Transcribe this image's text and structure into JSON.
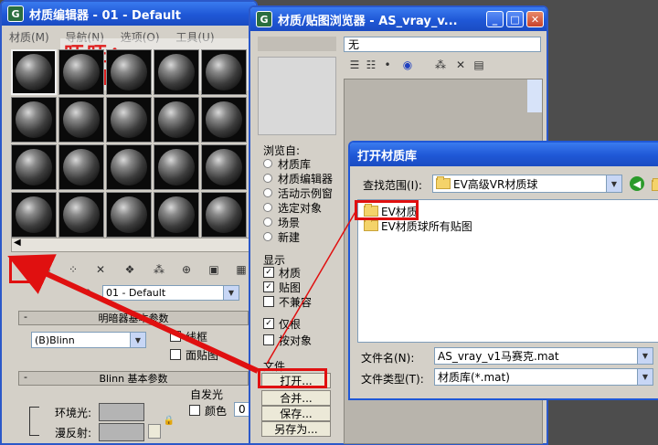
{
  "watermark": "旺旺：tailin188",
  "material_editor": {
    "title": "材质编辑器 - 01 - Default",
    "menu": [
      "材质(M)",
      "导航(N)",
      "选项(O)",
      "工具(U)"
    ],
    "material_name": "01 - Default",
    "basic_params_title": "明暗器基本参数",
    "shader": "(B)Blinn",
    "wire_label": "线框",
    "faceted_label": "面贴图",
    "blinn_title": "Blinn 基本参数",
    "self_illum_label": "自发光",
    "color_label": "颜色",
    "color_value": "0",
    "ambient_label": "环境光:",
    "diffuse_label": "漫反射:"
  },
  "browser": {
    "title": "材质/贴图浏览器 - AS_vray_v...",
    "name_value": "无",
    "browse_from_label": "浏览自:",
    "browse_from": [
      "材质库",
      "材质编辑器",
      "活动示例窗",
      "选定对象",
      "场景",
      "新建"
    ],
    "show_label": "显示",
    "show": [
      {
        "label": "材质",
        "checked": true
      },
      {
        "label": "贴图",
        "checked": true
      },
      {
        "label": "不兼容",
        "checked": false
      }
    ],
    "root_label": "仅根",
    "by_object_label": "按对象",
    "file_label": "文件",
    "open_btn": "打开...",
    "merge_btn": "合并...",
    "save_btn": "保存...",
    "saveas_btn": "另存为..."
  },
  "open_dialog": {
    "title": "打开材质库",
    "lookin_label": "查找范围(I):",
    "lookin_value": "EV高级VR材质球",
    "files": [
      "EV材质",
      "EV材质球所有贴图"
    ],
    "filename_label": "文件名(N):",
    "filename_value": "AS_vray_v1马赛克.mat",
    "filetype_label": "文件类型(T):",
    "filetype_value": "材质库(*.mat)"
  },
  "colors": {
    "annotation_red": "#e01010",
    "titlebar_blue": "#1f57d6"
  }
}
